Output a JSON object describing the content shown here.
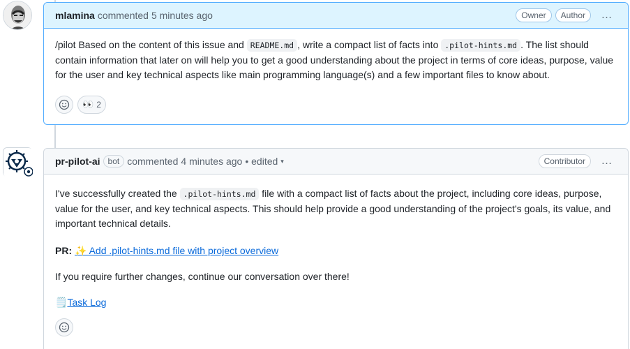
{
  "comment1": {
    "author": "mlamina",
    "action": "commented",
    "time": "5 minutes ago",
    "labels": [
      "Owner",
      "Author"
    ],
    "body": {
      "t1": "/pilot Based on the content of this issue and ",
      "code1": "README.md",
      "t2": ", write a compact list of facts into ",
      "code2": ".pilot-hints.md",
      "t3": ". The list should contain information that later on will help you to get a good understanding about the project in terms of core ideas, purpose, value for the user and key technical aspects like main programming language(s) and a few important files to know about."
    },
    "reactions": [
      {
        "emoji": "👀",
        "count": "2"
      }
    ]
  },
  "comment2": {
    "author": "pr-pilot-ai",
    "bot_label": "bot",
    "action": "commented",
    "time": "4 minutes ago",
    "edited": "• edited",
    "labels": [
      "Contributor"
    ],
    "body": {
      "t1": "I've successfully created the ",
      "code1": ".pilot-hints.md",
      "t2": " file with a compact list of facts about the project, including core ideas, purpose, value for the user, and key technical aspects. This should help provide a good understanding of the project's goals, its value, and important technical details.",
      "pr_label": "PR:",
      "pr_link": "✨ Add .pilot-hints.md file with project overview",
      "followup": "If you require further changes, continue our conversation over there!",
      "task_emoji": "🗒️",
      "task_link": "Task Log"
    }
  },
  "icons": {
    "kebab": "…",
    "smiley": "smiley-icon",
    "caret": "▾"
  }
}
